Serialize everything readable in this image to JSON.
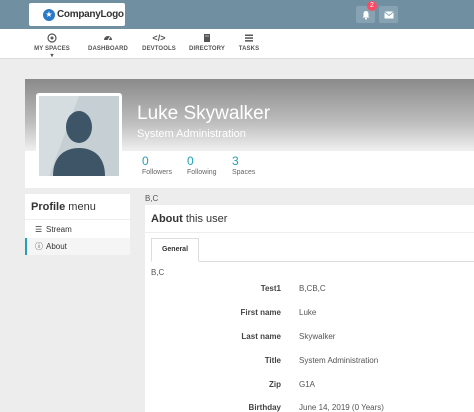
{
  "header": {
    "logo_text": "CompanyLogo",
    "notification_count": "2",
    "icons": [
      "bell-icon",
      "envelope-icon"
    ],
    "brand_color": "#708fa0"
  },
  "nav": {
    "items": [
      {
        "label": "MY SPACES",
        "icon": "target-icon"
      },
      {
        "label": "DASHBOARD",
        "icon": "dashboard-icon"
      },
      {
        "label": "DEVTOOLS",
        "icon": "code-icon"
      },
      {
        "label": "DIRECTORY",
        "icon": "book-icon"
      },
      {
        "label": "TASKS",
        "icon": "tasks-icon"
      }
    ]
  },
  "profile": {
    "name": "Luke Skywalker",
    "role": "System Administration",
    "stats": [
      {
        "value": "0",
        "label": "Followers"
      },
      {
        "value": "0",
        "label": "Following"
      },
      {
        "value": "3",
        "label": "Spaces"
      }
    ],
    "accent": "#21a1b3"
  },
  "sidebar": {
    "title_bold": "Profile",
    "title_rest": "menu",
    "items": [
      {
        "label": "Stream",
        "icon": "list-icon"
      },
      {
        "label": "About",
        "icon": "info-icon"
      }
    ]
  },
  "main": {
    "breadcrumb": "B,C",
    "title_bold": "About",
    "title_rest": "this user",
    "tab_label": "General",
    "section_note": "B,C",
    "fields": [
      {
        "label": "Test1",
        "value": "B,CB,C"
      },
      {
        "label": "First name",
        "value": "Luke"
      },
      {
        "label": "Last name",
        "value": "Skywalker"
      },
      {
        "label": "Title",
        "value": "System Administration"
      },
      {
        "label": "Zip",
        "value": "G1A"
      },
      {
        "label": "Birthday",
        "value": "June 14, 2019 (0 Years)"
      }
    ]
  }
}
